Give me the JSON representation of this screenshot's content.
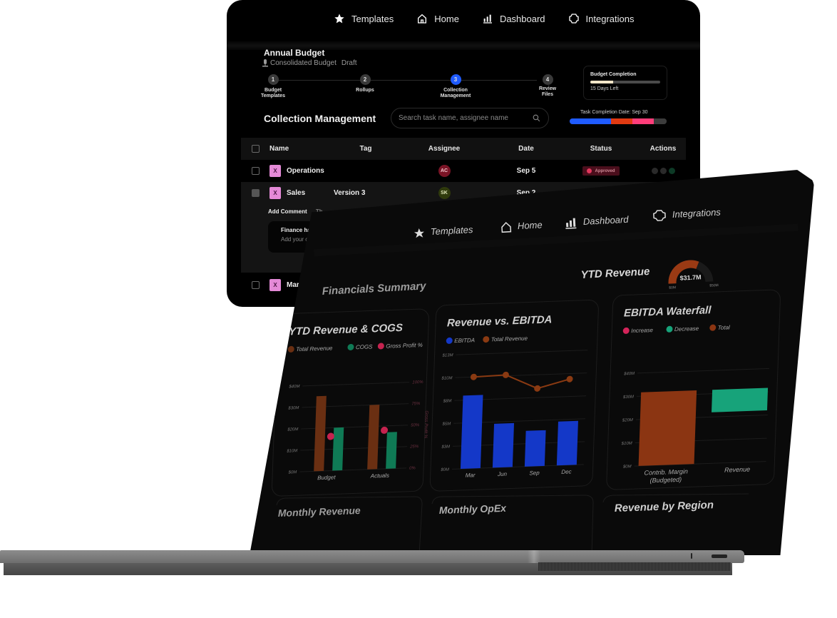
{
  "nav": {
    "items": [
      {
        "icon": "star-icon",
        "label": "Templates"
      },
      {
        "icon": "home-icon",
        "label": "Home"
      },
      {
        "icon": "bar-chart-icon",
        "label": "Dashboard"
      },
      {
        "icon": "puzzle-icon",
        "label": "Integrations"
      }
    ]
  },
  "budget": {
    "title": "Annual Budget",
    "subtitle": "Consolidated Budget",
    "status": "Draft",
    "steps": [
      {
        "num": "1",
        "label": "Budget Templates",
        "active": false
      },
      {
        "num": "2",
        "label": "Rollups",
        "active": false
      },
      {
        "num": "3",
        "label": "Collection Management",
        "active": true
      },
      {
        "num": "4",
        "label": "Review Files",
        "active": false
      }
    ],
    "completion": {
      "title": "Budget Completion",
      "progress": 0.33,
      "days_left": "15 Days Left"
    },
    "task_completion": {
      "label": "Task Completion Date: Sep 30",
      "segments": [
        {
          "color": "#1f5bff",
          "fraction": 0.43
        },
        {
          "color": "#e03a12",
          "fraction": 0.22
        },
        {
          "color": "#ff3d7a",
          "fraction": 0.22
        },
        {
          "color": "#3c3c3c",
          "fraction": 0.13
        }
      ]
    }
  },
  "collection": {
    "title": "Collection Management",
    "search_placeholder": "Search task name, assignee name",
    "columns": [
      "Name",
      "Tag",
      "Assignee",
      "Date",
      "Status",
      "Actions"
    ],
    "rows": [
      {
        "name": "Operations",
        "tag": "",
        "assignee": "AC",
        "assignee_color": "#7a1426",
        "assignee_text": "#f2c6cd",
        "date": "Sep 5",
        "status": "Approved"
      },
      {
        "name": "Sales",
        "tag": "Version 3",
        "assignee": "SK",
        "assignee_color": "#2f3a0c",
        "assignee_text": "#dfe6b8",
        "date": "Sep 2",
        "status": ""
      }
    ],
    "comment": {
      "header": "Add Comment",
      "header_extra": "Th",
      "title": "Finance ha",
      "placeholder": "Add your c"
    },
    "partial_row": {
      "name": "Mark"
    }
  },
  "dashboard": {
    "nav": [
      {
        "icon": "star-icon",
        "label": "Templates"
      },
      {
        "icon": "home-icon",
        "label": "Home"
      },
      {
        "icon": "bar-chart-icon",
        "label": "Dashboard"
      },
      {
        "icon": "puzzle-icon",
        "label": "Integrations"
      }
    ],
    "section_title": "Financials Summary",
    "ytd_revenue": {
      "label": "YTD Revenue",
      "value": "$31.7M",
      "min": "$0M",
      "max": "$50M",
      "fraction": 0.634
    },
    "bottom_panels": [
      "Monthly Revenue",
      "Monthly OpEx",
      "Revenue by Region"
    ]
  },
  "chart_data": [
    {
      "type": "bar",
      "title": "YTD Revenue & COGS",
      "categories": [
        "Budget",
        "Actuals"
      ],
      "series": [
        {
          "name": "Total Revenue",
          "color": "#6a2f12",
          "values": [
            35,
            30
          ]
        },
        {
          "name": "COGS",
          "color": "#0f7a55",
          "values": [
            20,
            17
          ]
        },
        {
          "name": "Gross Profit %",
          "color": "#c5234f",
          "axis": "right",
          "values": [
            40,
            45
          ]
        }
      ],
      "yticks": [
        "$0M",
        "$10M",
        "$20M",
        "$30M",
        "$40M"
      ],
      "ylim": [
        0,
        40
      ],
      "y2ticks": [
        "0%",
        "25%",
        "50%",
        "75%",
        "100%"
      ],
      "y2lim": [
        0,
        100
      ],
      "y2label": "Gross Profit %"
    },
    {
      "type": "bar",
      "title": "Revenue vs. EBITDA",
      "categories": [
        "Mar",
        "Jun",
        "Sep",
        "Dec"
      ],
      "series": [
        {
          "name": "EBITDA",
          "color": "#1438c8",
          "kind": "bar",
          "values": [
            8,
            4.8,
            3.9,
            4.8
          ]
        },
        {
          "name": "Total Revenue",
          "color": "#8a3a12",
          "kind": "line",
          "values": [
            10,
            10.1,
            8.5,
            9.4
          ]
        }
      ],
      "yticks": [
        "$0M",
        "$3M",
        "$5M",
        "$8M",
        "$10M",
        "$13M"
      ],
      "ylim": [
        0,
        12.5
      ]
    },
    {
      "type": "bar",
      "title": "EBITDA Waterfall",
      "categories": [
        "Contrib. Margin (Budgeted)",
        "Revenue"
      ],
      "legend": [
        {
          "name": "Increase",
          "color": "#d4245a"
        },
        {
          "name": "Decrease",
          "color": "#17a37a"
        },
        {
          "name": "Total",
          "color": "#8b3512"
        }
      ],
      "bars": [
        {
          "category": "Contrib. Margin (Budgeted)",
          "kind": "Total",
          "start": 0,
          "end": 31.7
        },
        {
          "category": "Revenue",
          "kind": "Decrease",
          "start": 31.7,
          "end": 22
        }
      ],
      "yticks": [
        "$0M",
        "$10M",
        "$20M",
        "$30M",
        "$40M"
      ],
      "ylim": [
        0,
        40
      ]
    }
  ]
}
